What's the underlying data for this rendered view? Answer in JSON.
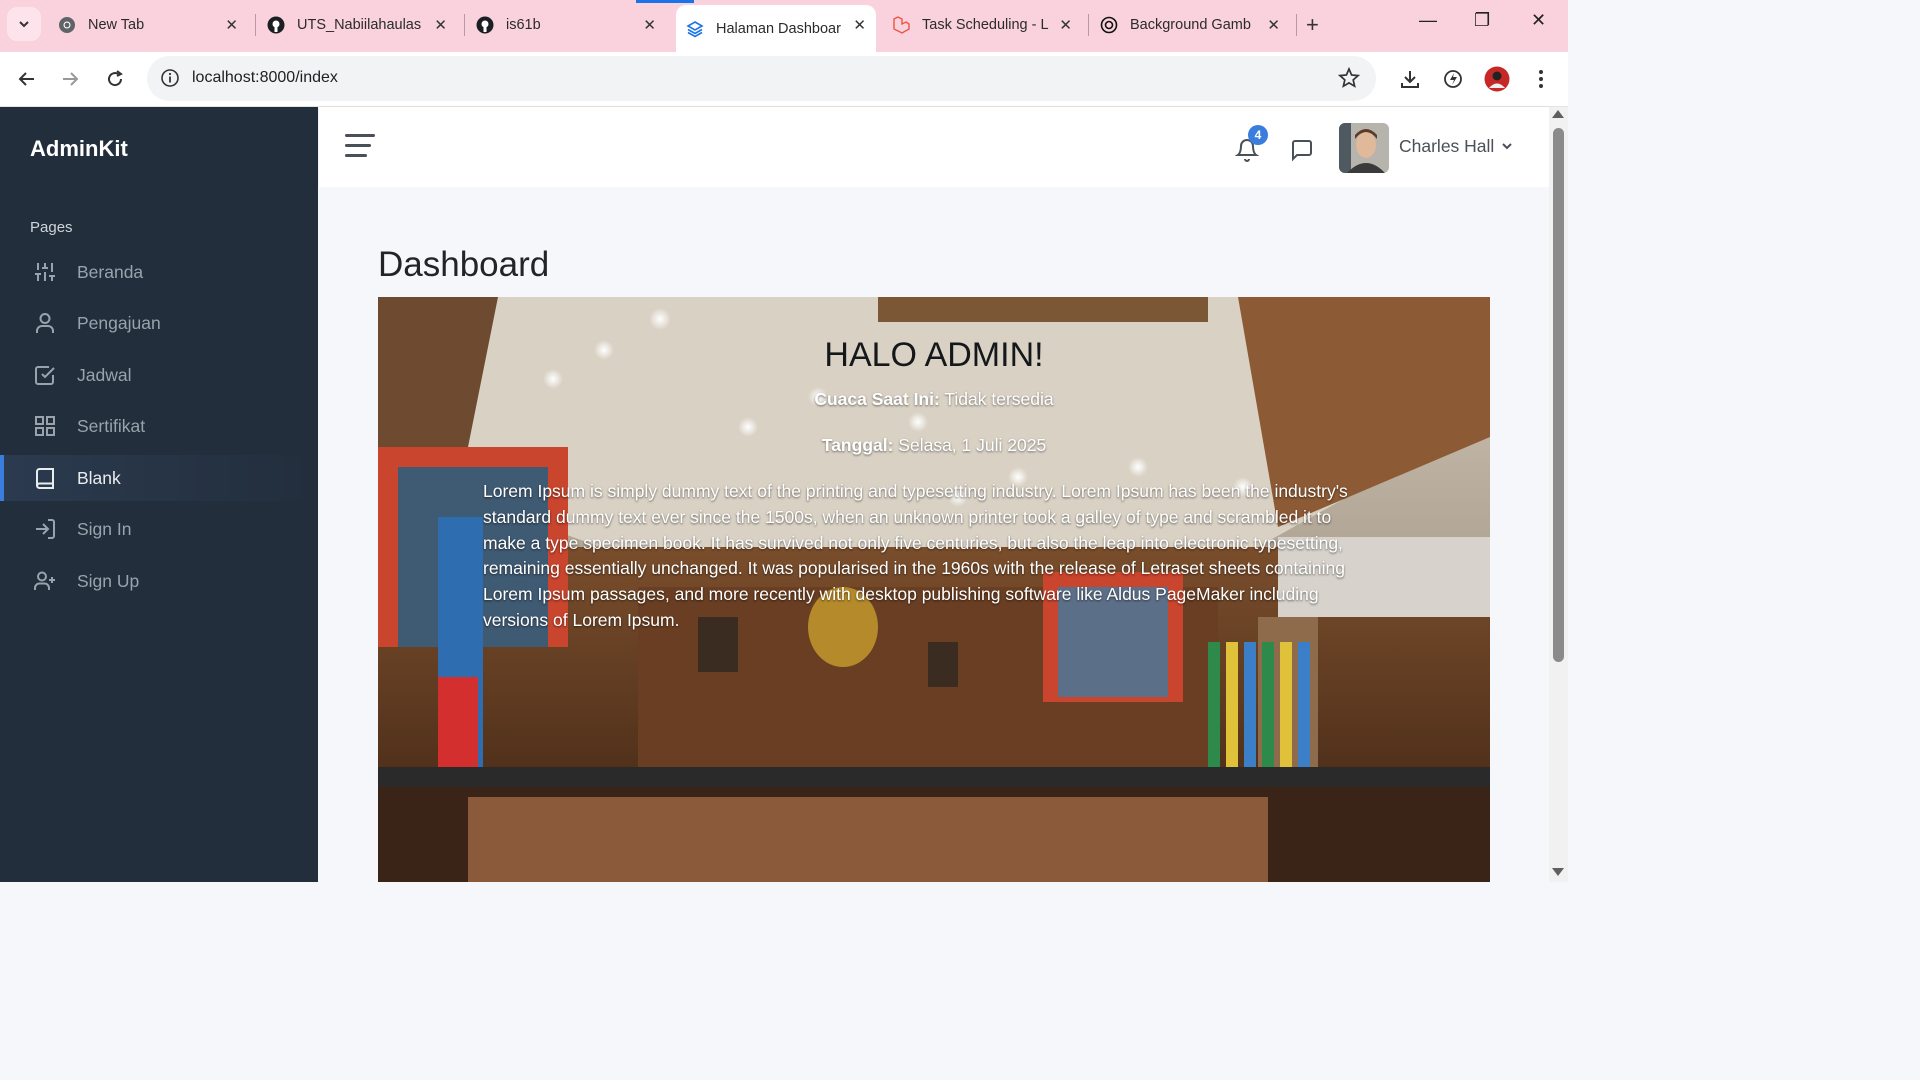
{
  "browser": {
    "tabs": [
      {
        "title": "New Tab",
        "icon": "chrome-icon"
      },
      {
        "title": "UTS_Nabiilahaulas",
        "icon": "github-icon"
      },
      {
        "title": "is61b",
        "icon": "github-icon"
      },
      {
        "title": "Halaman Dashboar",
        "icon": "layers-icon",
        "active": true
      },
      {
        "title": "Task Scheduling - L",
        "icon": "laravel-icon"
      },
      {
        "title": "Background Gamb",
        "icon": "openai-icon"
      }
    ],
    "url": "localhost:8000/index",
    "accent": "#1a73e8",
    "tabbar_color": "#f9d2de"
  },
  "sidebar": {
    "brand": "AdminKit",
    "section": "Pages",
    "items": [
      {
        "label": "Beranda",
        "icon": "sliders-icon"
      },
      {
        "label": "Pengajuan",
        "icon": "user-icon"
      },
      {
        "label": "Jadwal",
        "icon": "check-square-icon"
      },
      {
        "label": "Sertifikat",
        "icon": "grid-icon"
      },
      {
        "label": "Blank",
        "icon": "book-icon",
        "active": true
      },
      {
        "label": "Sign In",
        "icon": "log-in-icon"
      },
      {
        "label": "Sign Up",
        "icon": "user-plus-icon"
      }
    ],
    "bg_color": "#222e3c",
    "active_color": "#3b7ddd"
  },
  "topbar": {
    "notifications_count": "4",
    "user_name": "Charles Hall"
  },
  "main": {
    "title": "Dashboard",
    "greeting": "HALO ADMIN!",
    "weather_label": "Cuaca Saat Ini:",
    "weather_value": " Tidak tersedia",
    "date_label": "Tanggal:",
    "date_value": " Selasa, 1 Juli 2025",
    "paragraph": "Lorem Ipsum is simply dummy text of the printing and typesetting industry. Lorem Ipsum has been the industry's standard dummy text ever since the 1500s, when an unknown printer took a galley of type and scrambled it to make a type specimen book. It has survived not only five centuries, but also the leap into electronic typesetting, remaining essentially unchanged. It was popularised in the 1960s with the release of Letraset sheets containing Lorem Ipsum passages, and more recently with desktop publishing software like Aldus PageMaker including versions of Lorem Ipsum."
  }
}
